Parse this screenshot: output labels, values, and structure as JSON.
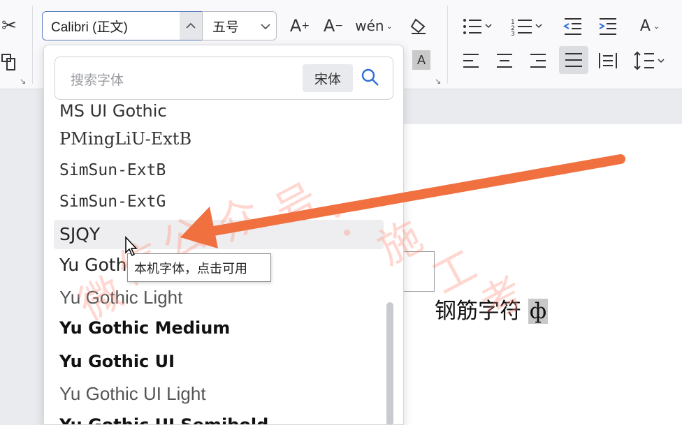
{
  "ribbon": {
    "font_name": "Calibri (正文)",
    "font_size": "五号",
    "icons": [
      "cut-icon",
      "format-painter-icon",
      "grow-font-icon",
      "shrink-font-icon",
      "phonetic-guide-icon",
      "clear-format-icon",
      "bullets-icon",
      "numbering-icon",
      "decrease-indent-icon",
      "increase-indent-icon",
      "text-direction-icon",
      "char-shading-icon",
      "align-left-icon",
      "align-center-icon",
      "align-right-icon",
      "justify-icon",
      "distributed-icon",
      "line-spacing-icon"
    ],
    "grow_font_glyph": "A⁺",
    "shrink_font_glyph": "A⁻",
    "phonetic_glyph": "wén",
    "char_shading_glyph": "A",
    "accent_color": "#5b7fbf"
  },
  "font_dropdown": {
    "search_placeholder": "搜索字体",
    "search_chip": "宋体",
    "fonts": [
      {
        "name": "MS UI Gothic",
        "style": "cut"
      },
      {
        "name": "PMingLiU-ExtB",
        "style": "serif"
      },
      {
        "name": "SimSun-ExtB",
        "style": "mono"
      },
      {
        "name": "SimSun-ExtG",
        "style": "mono"
      },
      {
        "name": "SJQY",
        "style": "sans",
        "hover": true
      },
      {
        "name": "Yu Gothic",
        "style": "sans"
      },
      {
        "name": "Yu Gothic Light",
        "style": "light"
      },
      {
        "name": "Yu Gothic Medium",
        "style": "medium"
      },
      {
        "name": "Yu Gothic UI",
        "style": "medium"
      },
      {
        "name": "Yu Gothic UI Light",
        "style": "light"
      },
      {
        "name": "Yu Gothic UI Semibold",
        "style": "bold"
      }
    ],
    "tooltip": "本机字体，点击可用"
  },
  "document": {
    "text": "钢筋字符",
    "special_char": "ф"
  },
  "watermark": {
    "chars": [
      "微",
      "信",
      "公",
      "众",
      "号",
      "：",
      "施",
      "工",
      "考"
    ],
    "color": "#ff8c78"
  },
  "annotation_arrow_color": "#f07040"
}
